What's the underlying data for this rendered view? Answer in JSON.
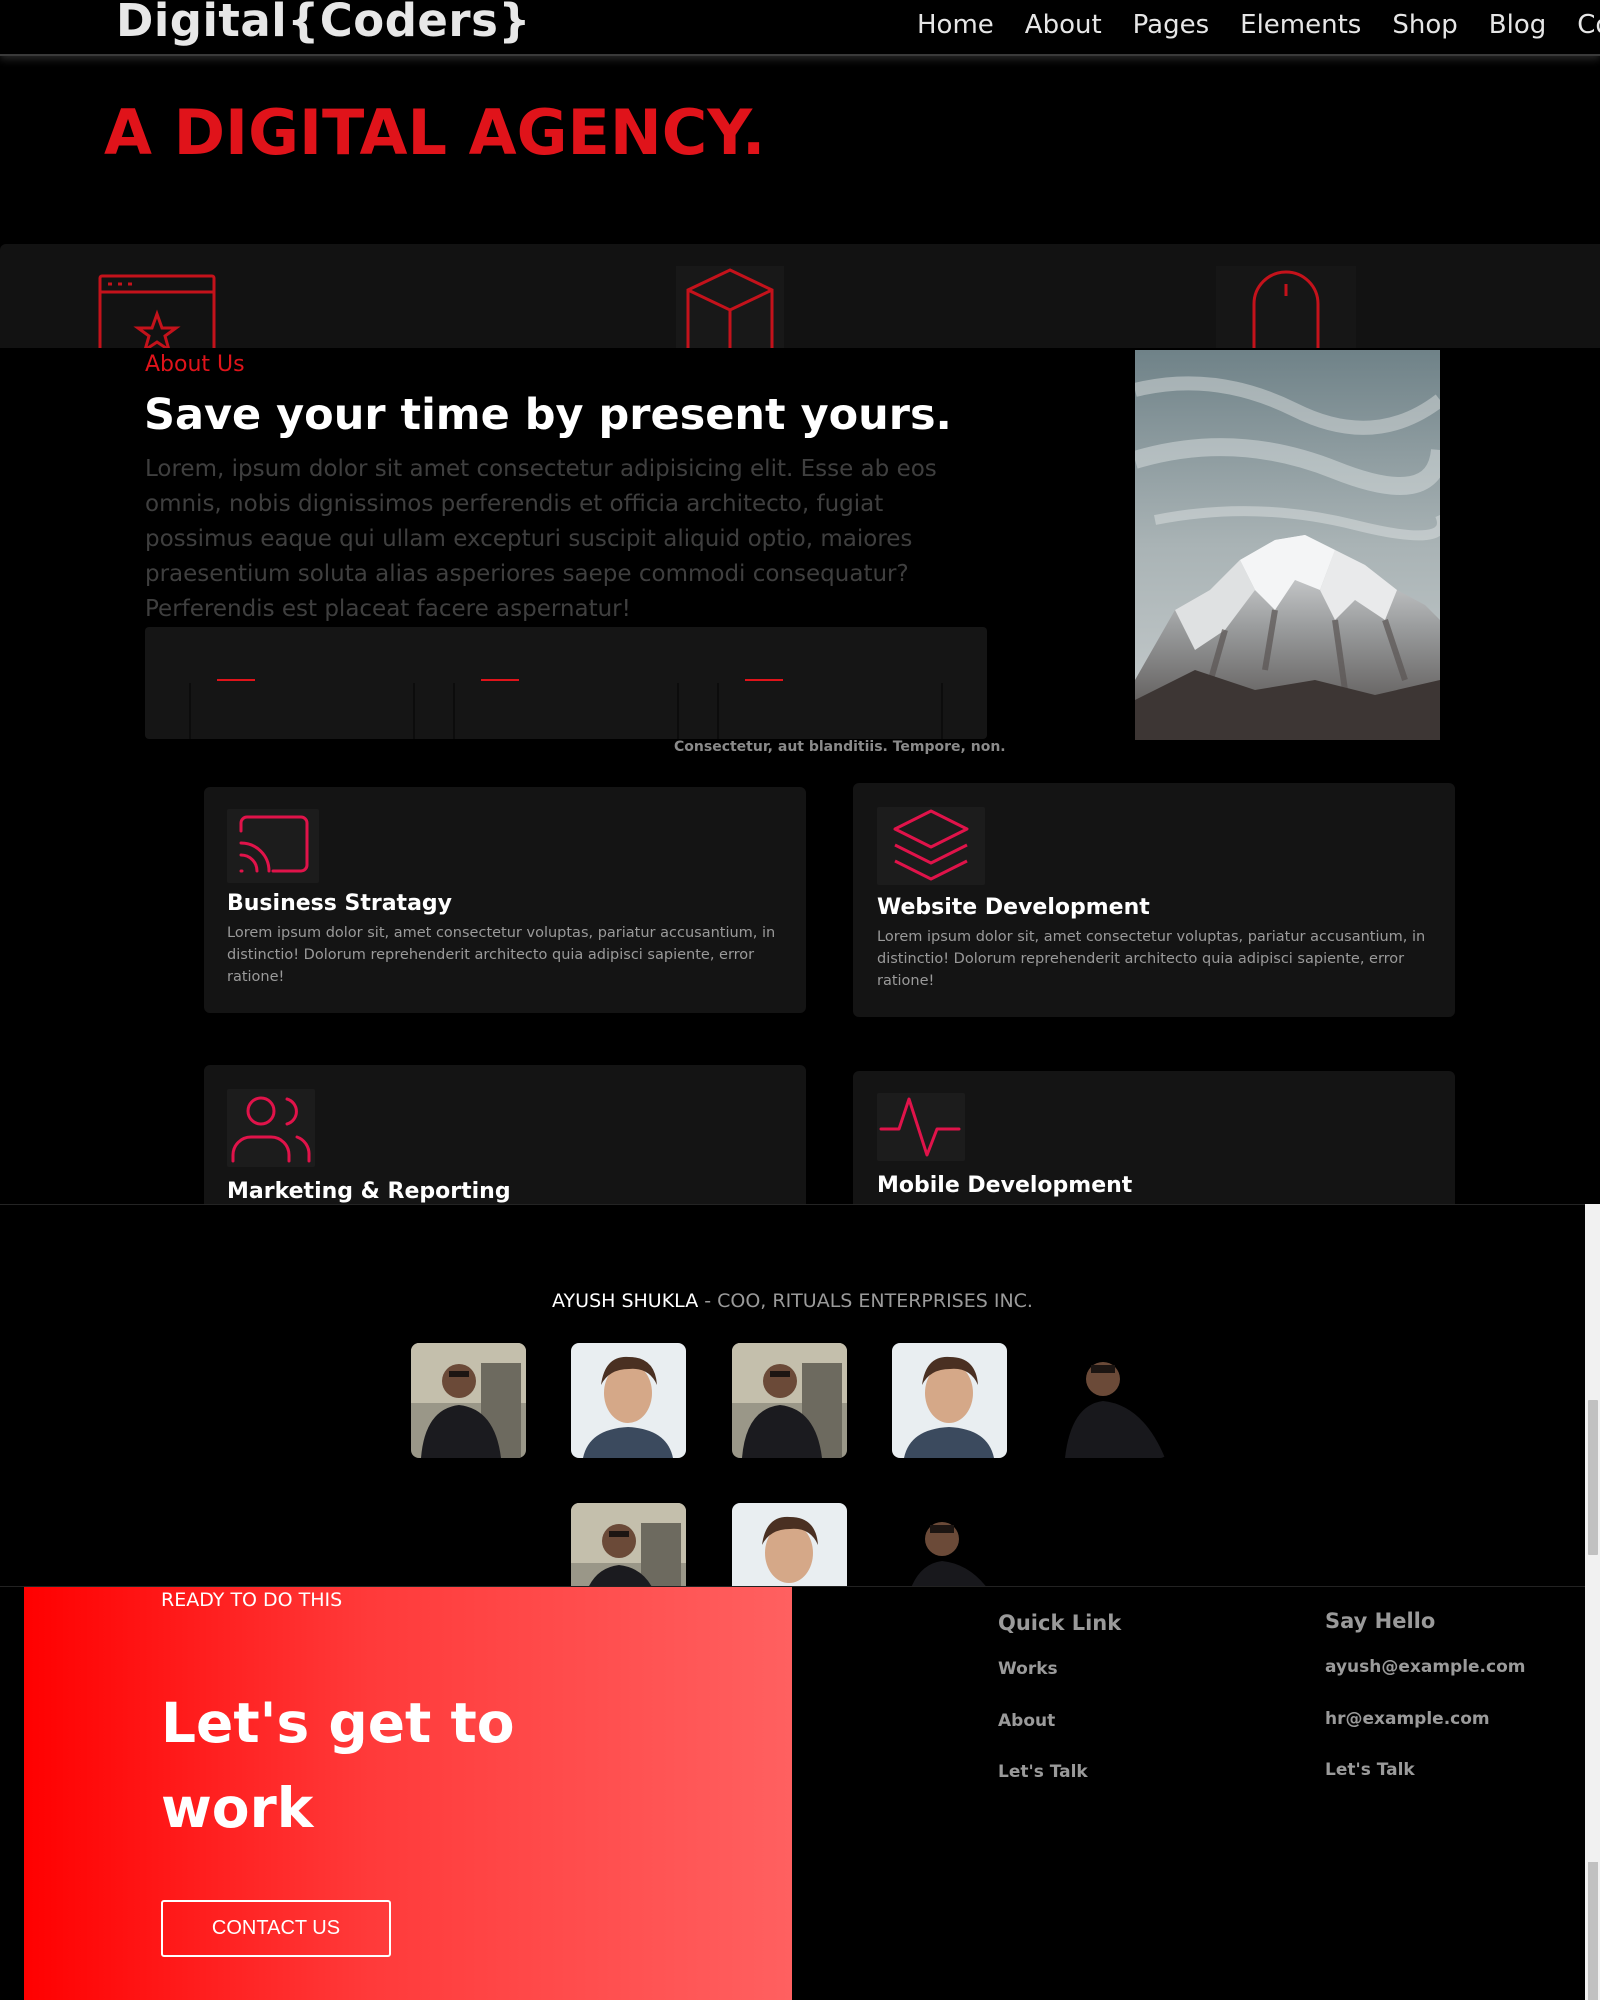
{
  "header": {
    "logo": "Digital{Coders}",
    "nav": [
      "Home",
      "About",
      "Pages",
      "Elements",
      "Shop",
      "Blog",
      "Co"
    ]
  },
  "hero": {
    "headline": "A DIGITAL AGENCY."
  },
  "about": {
    "label": "About Us",
    "title": "Save your time by present yours.",
    "text": "Lorem, ipsum dolor sit amet consectetur adipisicing elit. Esse ab eos omnis, nobis dignissimos perferendis et officia architecto, fugiat possimus eaque qui ullam excepturi suscipit aliquid optio, maiores praesentium soluta alias asperiores saepe commodi consequatur? Perferendis est placeat facere aspernatur!",
    "caption": "Consectetur, aut blanditiis. Tempore, non."
  },
  "services": [
    {
      "title": "Business Stratagy",
      "desc": "Lorem ipsum dolor sit, amet consectetur voluptas, pariatur accusantium, in distinctio! Dolorum reprehenderit architecto quia adipisci sapiente, error ratione!",
      "icon": "cast-icon"
    },
    {
      "title": "Website Development",
      "desc": "Lorem ipsum dolor sit, amet consectetur voluptas, pariatur accusantium, in distinctio! Dolorum reprehenderit architecto quia adipisci sapiente, error ratione!",
      "icon": "layers-icon"
    },
    {
      "title": "Marketing & Reporting",
      "desc": "",
      "icon": "users-icon"
    },
    {
      "title": "Mobile Development",
      "desc": "",
      "icon": "activity-icon"
    }
  ],
  "testimonial": {
    "name": "AYUSH SHUKLA",
    "separator": " - ",
    "role": "COO, RITUALS ENTERPRISES INC."
  },
  "cta": {
    "kicker": "READY TO DO THIS",
    "title": "Let's get to work",
    "button": "CONTACT US"
  },
  "footer": {
    "quick_link_title": "Quick Link",
    "quick_links": [
      "Works",
      "About",
      "Let's Talk"
    ],
    "say_hello_title": "Say Hello",
    "hello_links": [
      "ayush@example.com",
      "hr@example.com",
      "Let's Talk"
    ]
  },
  "colors": {
    "accent": "#e0131a",
    "background": "#000000",
    "card": "#141414"
  }
}
